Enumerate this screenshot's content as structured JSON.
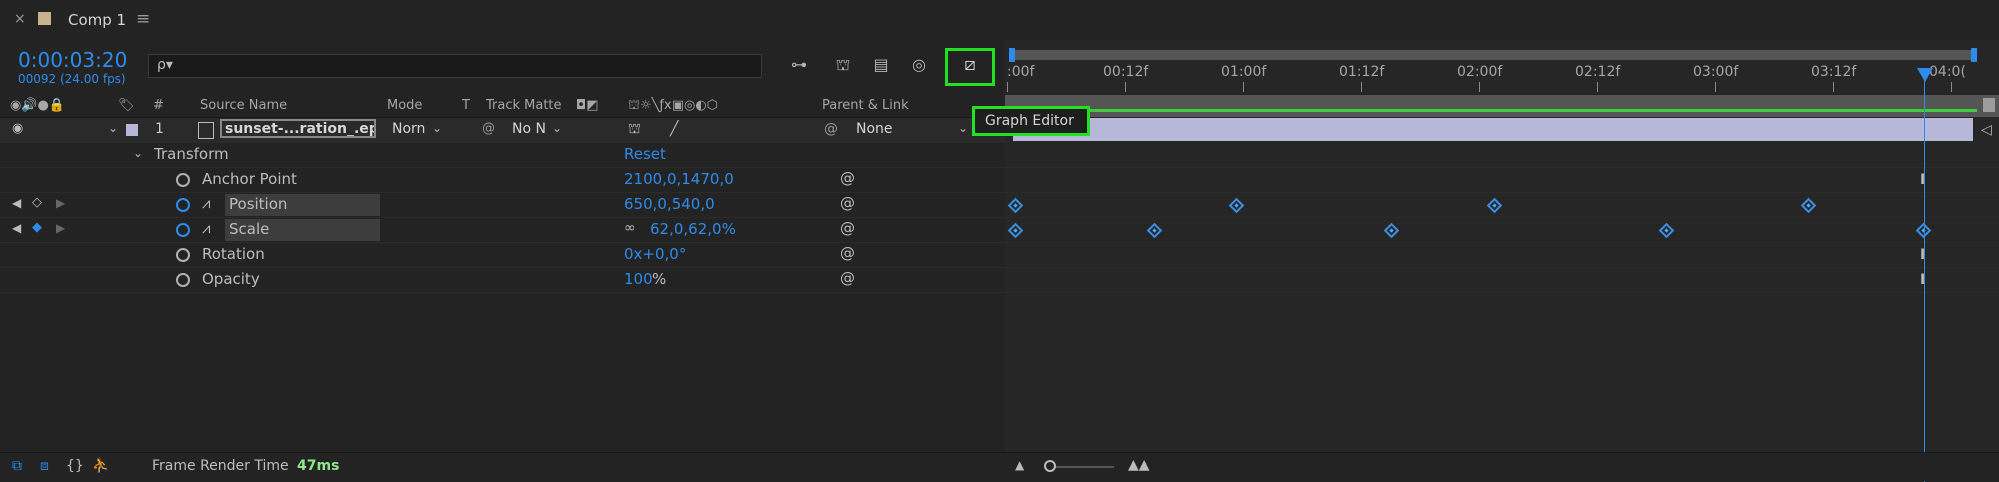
{
  "tab": {
    "close": "×",
    "title": "Comp 1",
    "menu": "≡"
  },
  "time": {
    "current": "0:00:03:20",
    "frame_info": "00092 (24.00 fps)"
  },
  "search": {
    "placeholder": "ρ▾"
  },
  "columns": {
    "num": "#",
    "source_name": "Source Name",
    "mode": "Mode",
    "t": "T",
    "track_matte": "Track Matte",
    "parent_link": "Parent & Link"
  },
  "layer": {
    "number": "1",
    "name": "sunset-...ration_.eps",
    "mode": "Norn",
    "track_matte": "No N",
    "parent": "None"
  },
  "transform": {
    "label": "Transform",
    "reset": "Reset",
    "anchor_point": {
      "label": "Anchor Point",
      "value": "2100,0,1470,0"
    },
    "position": {
      "label": "Position",
      "value": "650,0,540,0"
    },
    "scale": {
      "label": "Scale",
      "value": "62,0,62,0%"
    },
    "rotation": {
      "label": "Rotation",
      "value": "0x+0,0°"
    },
    "opacity": {
      "label": "Opacity",
      "value": "100",
      "unit": "%"
    }
  },
  "tooltip": {
    "graph_editor": "Graph Editor"
  },
  "ruler": {
    "ticks": [
      ":00f",
      "00:12f",
      "01:00f",
      "01:12f",
      "02:00f",
      "02:12f",
      "03:00f",
      "03:12f",
      "04:0("
    ]
  },
  "bottom": {
    "label": "Frame Render Time",
    "value": "47ms"
  },
  "colors": {
    "accent": "#2d8ceb",
    "highlight": "#22e022",
    "layer_bar": "#b7b7d9"
  }
}
